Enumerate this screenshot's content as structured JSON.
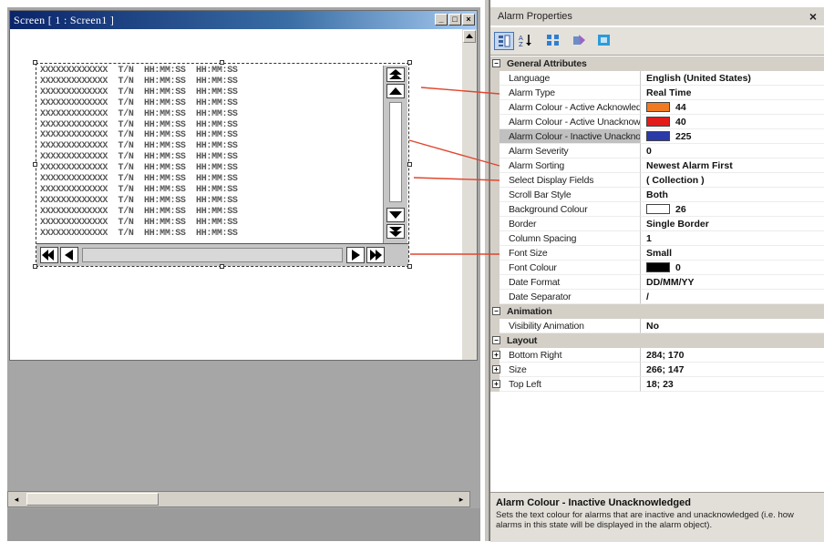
{
  "screen_window": {
    "title": "Screen [ 1 : Screen1 ]",
    "buttons": {
      "minimize": "_",
      "maximize": "□",
      "close": "×"
    }
  },
  "alarm_rows": [
    "XXXXXXXXXXXXX  T/N  HH:MM:SS  HH:MM:SS",
    "XXXXXXXXXXXXX  T/N  HH:MM:SS  HH:MM:SS",
    "XXXXXXXXXXXXX  T/N  HH:MM:SS  HH:MM:SS",
    "XXXXXXXXXXXXX  T/N  HH:MM:SS  HH:MM:SS",
    "XXXXXXXXXXXXX  T/N  HH:MM:SS  HH:MM:SS",
    "XXXXXXXXXXXXX  T/N  HH:MM:SS  HH:MM:SS",
    "XXXXXXXXXXXXX  T/N  HH:MM:SS  HH:MM:SS",
    "XXXXXXXXXXXXX  T/N  HH:MM:SS  HH:MM:SS",
    "XXXXXXXXXXXXX  T/N  HH:MM:SS  HH:MM:SS",
    "XXXXXXXXXXXXX  T/N  HH:MM:SS  HH:MM:SS",
    "XXXXXXXXXXXXX  T/N  HH:MM:SS  HH:MM:SS",
    "XXXXXXXXXXXXX  T/N  HH:MM:SS  HH:MM:SS",
    "XXXXXXXXXXXXX  T/N  HH:MM:SS  HH:MM:SS",
    "XXXXXXXXXXXXX  T/N  HH:MM:SS  HH:MM:SS",
    "XXXXXXXXXXXXX  T/N  HH:MM:SS  HH:MM:SS",
    "XXXXXXXXXXXXX  T/N  HH:MM:SS  HH:MM:SS"
  ],
  "properties_panel": {
    "title": "Alarm Properties",
    "close_glyph": "×",
    "toolbar_icons": [
      "categorized-icon",
      "alphabetical-icon",
      "events-icon",
      "property-pages-icon",
      "export-icon"
    ],
    "categories": {
      "general": "General Attributes",
      "animation": "Animation",
      "layout": "Layout"
    },
    "rows": {
      "language": {
        "name": "Language",
        "value": "English (United States)"
      },
      "alarm_type": {
        "name": "Alarm Type",
        "value": "Real Time"
      },
      "colour_active_ack": {
        "name": "Alarm Colour - Active Acknowledged",
        "value": "44",
        "swatch": "#f07a22"
      },
      "colour_active_unack": {
        "name": "Alarm Colour - Active Unacknowledged",
        "value": "40",
        "swatch": "#e21b1b"
      },
      "colour_inactive_unack": {
        "name": "Alarm Colour - Inactive Unacknowledged",
        "value": "225",
        "swatch": "#2a3aa8"
      },
      "severity": {
        "name": "Alarm Severity",
        "value": "0"
      },
      "sorting": {
        "name": "Alarm Sorting",
        "value": "Newest Alarm First"
      },
      "display_fields": {
        "name": "Select Display Fields",
        "value": "( Collection )"
      },
      "scroll_bar_style": {
        "name": "Scroll Bar Style",
        "value": "Both"
      },
      "background_colour": {
        "name": "Background Colour",
        "value": "26",
        "swatch": "#ffffff"
      },
      "border": {
        "name": "Border",
        "value": "Single Border"
      },
      "column_spacing": {
        "name": "Column Spacing",
        "value": "1"
      },
      "font_size": {
        "name": "Font Size",
        "value": "Small"
      },
      "font_colour": {
        "name": "Font Colour",
        "value": "0",
        "swatch": "#000000"
      },
      "date_format": {
        "name": "Date Format",
        "value": "DD/MM/YY"
      },
      "date_separator": {
        "name": "Date Separator",
        "value": "/"
      },
      "visibility_animation": {
        "name": "Visibility Animation",
        "value": "No"
      },
      "bottom_right": {
        "name": "Bottom Right",
        "value": "284; 170"
      },
      "size": {
        "name": "Size",
        "value": "266; 147"
      },
      "top_left": {
        "name": "Top Left",
        "value": "18; 23"
      }
    },
    "description": {
      "title": "Alarm Colour - Inactive Unacknowledged",
      "text": "Sets the text colour for alarms that are inactive and unacknowledged (i.e. how alarms in this state will be displayed in the alarm object)."
    }
  },
  "colors": {
    "annotation_line": "#e0462e",
    "titlebar_start": "#0a246a",
    "selection": "#c0c0c0"
  }
}
